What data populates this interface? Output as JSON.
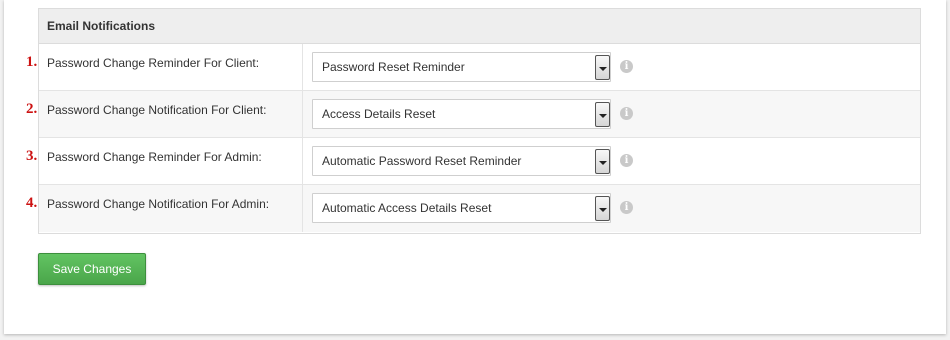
{
  "panel": {
    "title": "Email Notifications"
  },
  "rows": [
    {
      "number": "1.",
      "label": "Password Change Reminder For Client:",
      "selected": "Password Reset Reminder"
    },
    {
      "number": "2.",
      "label": "Password Change Notification For Client:",
      "selected": "Access Details Reset"
    },
    {
      "number": "3.",
      "label": "Password Change Reminder For Admin:",
      "selected": "Automatic Password Reset Reminder"
    },
    {
      "number": "4.",
      "label": "Password Change Notification For Admin:",
      "selected": "Automatic Access Details Reset"
    }
  ],
  "info_icon_glyph": "i",
  "actions": {
    "save_label": "Save Changes"
  },
  "colors": {
    "annotation_number": "#cc1111",
    "save_button": "#5cb85c"
  }
}
